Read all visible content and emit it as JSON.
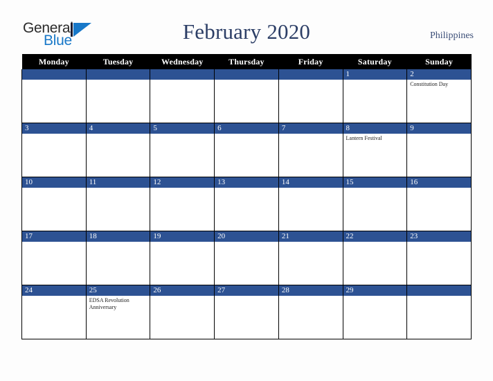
{
  "brand": {
    "word_one": "General",
    "word_two": "Blue",
    "triangle_icon": "triangle-icon",
    "accent_blue": "#1878c8",
    "dark": "#2b2b2b"
  },
  "header": {
    "title": "February 2020",
    "country": "Philippines"
  },
  "theme": {
    "header_row_bg": "#000000",
    "day_number_bg": "#2d5293",
    "title_color": "#2c3e66",
    "page_bg": "#fdfdfd",
    "grid_line": "#000000"
  },
  "calendar": {
    "month": "February",
    "year": "2020",
    "weekday_headers": [
      "Monday",
      "Tuesday",
      "Wednesday",
      "Thursday",
      "Friday",
      "Saturday",
      "Sunday"
    ],
    "weeks": [
      {
        "days": [
          {
            "num": "",
            "events": []
          },
          {
            "num": "",
            "events": []
          },
          {
            "num": "",
            "events": []
          },
          {
            "num": "",
            "events": []
          },
          {
            "num": "",
            "events": []
          },
          {
            "num": "1",
            "events": []
          },
          {
            "num": "2",
            "events": [
              "Constitution Day"
            ]
          }
        ]
      },
      {
        "days": [
          {
            "num": "3",
            "events": []
          },
          {
            "num": "4",
            "events": []
          },
          {
            "num": "5",
            "events": []
          },
          {
            "num": "6",
            "events": []
          },
          {
            "num": "7",
            "events": []
          },
          {
            "num": "8",
            "events": [
              "Lantern Festival"
            ]
          },
          {
            "num": "9",
            "events": []
          }
        ]
      },
      {
        "days": [
          {
            "num": "10",
            "events": []
          },
          {
            "num": "11",
            "events": []
          },
          {
            "num": "12",
            "events": []
          },
          {
            "num": "13",
            "events": []
          },
          {
            "num": "14",
            "events": []
          },
          {
            "num": "15",
            "events": []
          },
          {
            "num": "16",
            "events": []
          }
        ]
      },
      {
        "days": [
          {
            "num": "17",
            "events": []
          },
          {
            "num": "18",
            "events": []
          },
          {
            "num": "19",
            "events": []
          },
          {
            "num": "20",
            "events": []
          },
          {
            "num": "21",
            "events": []
          },
          {
            "num": "22",
            "events": []
          },
          {
            "num": "23",
            "events": []
          }
        ]
      },
      {
        "days": [
          {
            "num": "24",
            "events": []
          },
          {
            "num": "25",
            "events": [
              "EDSA Revolution Anniversary"
            ]
          },
          {
            "num": "26",
            "events": []
          },
          {
            "num": "27",
            "events": []
          },
          {
            "num": "28",
            "events": []
          },
          {
            "num": "29",
            "events": []
          },
          {
            "num": "",
            "events": []
          }
        ]
      }
    ]
  }
}
